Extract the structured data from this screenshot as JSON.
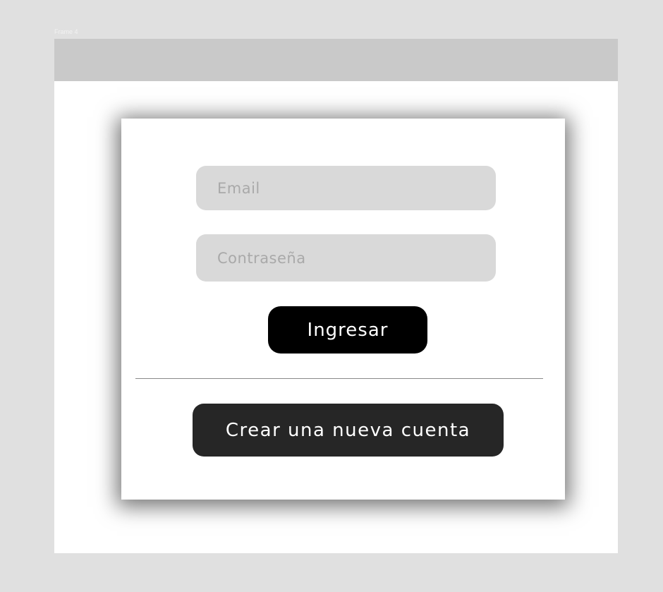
{
  "frame": {
    "label": "Frame 4"
  },
  "login_form": {
    "email_placeholder": "Email",
    "password_placeholder": "Contraseña",
    "login_button": "Ingresar",
    "create_account_button": "Crear una nueva cuenta"
  },
  "colors": {
    "canvas_bg": "#e0e0e0",
    "header_bar": "#c9c9c9",
    "input_bg": "#d9d9d9",
    "primary_button": "#000000",
    "secondary_button": "#262626"
  }
}
